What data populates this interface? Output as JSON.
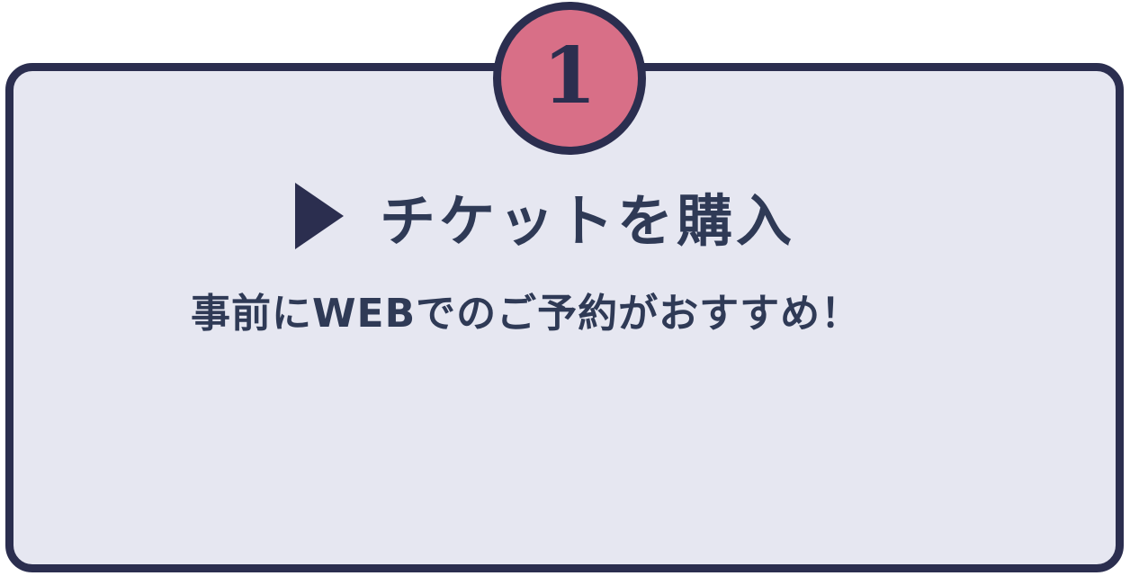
{
  "step": {
    "number": "1"
  },
  "heading": {
    "icon": "play-triangle-icon",
    "text": "チケットを購入"
  },
  "subtext": "事前にWEBでのご予約がおすすめ！",
  "colors": {
    "card_background": "#e6e7f1",
    "border": "#2b2e4f",
    "badge": "#d86f87",
    "text": "#2f3a56"
  }
}
